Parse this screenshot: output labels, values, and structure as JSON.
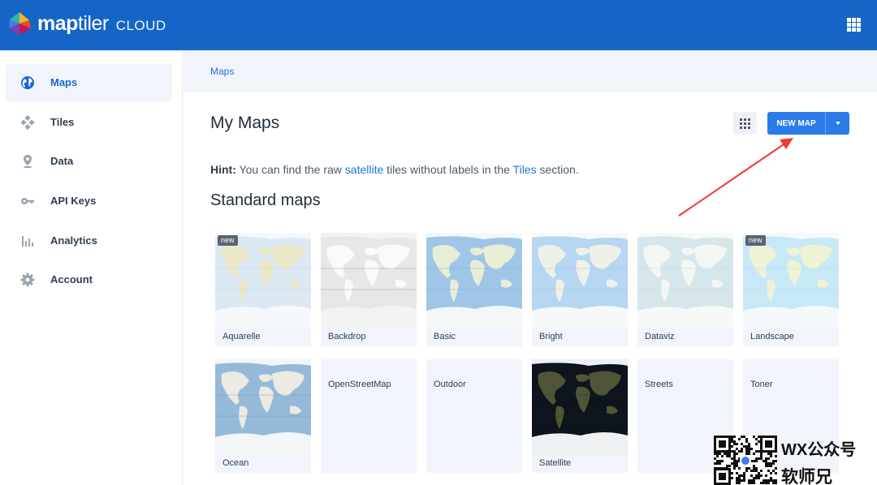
{
  "header": {
    "brand_bold": "map",
    "brand_light": "tiler",
    "brand_suffix": "CLOUD",
    "apps_icon": "grid-apps-icon",
    "color": "#1565c7"
  },
  "sidebar": {
    "items": [
      {
        "label": "Maps",
        "icon": "globe-icon",
        "active": true
      },
      {
        "label": "Tiles",
        "icon": "tiles-icon",
        "active": false
      },
      {
        "label": "Data",
        "icon": "pin-icon",
        "active": false
      },
      {
        "label": "API Keys",
        "icon": "key-icon",
        "active": false
      },
      {
        "label": "Analytics",
        "icon": "bar-chart-icon",
        "active": false
      },
      {
        "label": "Account",
        "icon": "gear-icon",
        "active": false
      }
    ]
  },
  "breadcrumb": "Maps",
  "page_title": "My Maps",
  "actions": {
    "grid_toggle_icon": "grid-view-icon",
    "new_map_label": "NEW MAP",
    "dropdown_icon": "caret-down-icon",
    "accent": "#2b7ce8"
  },
  "hint": {
    "prefix": "Hint:",
    "text1": "You can find the raw",
    "link1": "satellite",
    "text2": "tiles without labels in the",
    "link2": "Tiles",
    "text3": "section."
  },
  "section_title": "Standard maps",
  "maps": [
    {
      "name": "Aquarelle",
      "badge": "new",
      "style": "aquarelle"
    },
    {
      "name": "Backdrop",
      "badge": "",
      "style": "backdrop"
    },
    {
      "name": "Basic",
      "badge": "",
      "style": "basic"
    },
    {
      "name": "Bright",
      "badge": "",
      "style": "bright"
    },
    {
      "name": "Dataviz",
      "badge": "",
      "style": "dataviz"
    },
    {
      "name": "Landscape",
      "badge": "new",
      "style": "landscape"
    },
    {
      "name": "Ocean",
      "badge": "",
      "style": "ocean"
    },
    {
      "name": "OpenStreetMap",
      "badge": "",
      "style": "none"
    },
    {
      "name": "Outdoor",
      "badge": "",
      "style": "none"
    },
    {
      "name": "Satellite",
      "badge": "",
      "style": "satellite"
    },
    {
      "name": "Streets",
      "badge": "",
      "style": "none"
    },
    {
      "name": "Toner",
      "badge": "",
      "style": "none"
    }
  ],
  "watermark": {
    "line1": "WX公众号",
    "line2": "软师兄"
  }
}
